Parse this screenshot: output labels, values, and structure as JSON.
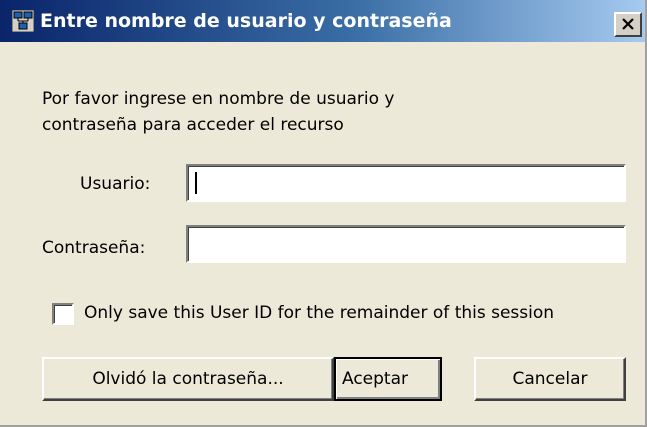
{
  "window": {
    "title": "Entre nombre de usuario y contraseña",
    "close_glyph": "×",
    "app_icon": "network-computers-icon",
    "close_icon": "close-icon"
  },
  "form": {
    "instruction_line1": "Por favor ingrese en nombre de usuario y",
    "instruction_line2": "contraseña para acceder el recurso",
    "username_label": "Usuario:",
    "username_value": "",
    "password_label": "Contraseña:",
    "password_value": "",
    "session_checkbox_label": "Only save this User ID for the remainder of this session",
    "session_checkbox_checked": false
  },
  "buttons": {
    "forgot_password": "Olvidó la contraseña...",
    "accept": "Aceptar",
    "cancel": "Cancelar"
  },
  "colors": {
    "titlebar_start": "#0a246a",
    "titlebar_end": "#a6caf0",
    "dialog_background": "#ece9d8"
  }
}
